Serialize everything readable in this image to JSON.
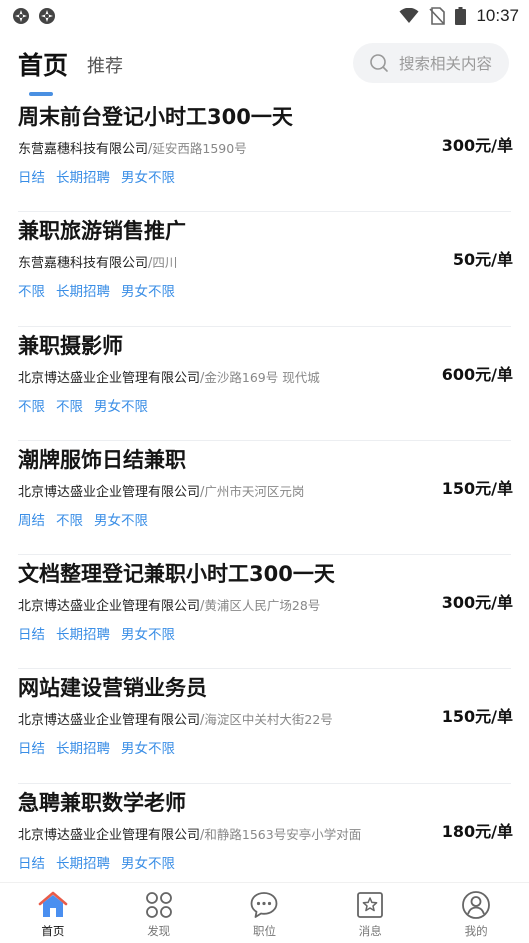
{
  "status_bar": {
    "time": "10:37",
    "icons": [
      "app-notification-icon",
      "app-notification-icon",
      "wifi-icon",
      "no-sim-icon",
      "battery-icon"
    ]
  },
  "header": {
    "tabs": [
      {
        "label": "首页",
        "active": true
      },
      {
        "label": "推荐",
        "active": false
      }
    ],
    "search_placeholder": "搜索相关内容"
  },
  "jobs": [
    {
      "title": "周末前台登记小时工300一天",
      "company": "东营嘉穗科技有限公司",
      "location": "延安西路1590号",
      "tags": [
        "日结",
        "长期招聘",
        "男女不限"
      ],
      "salary": "300元/单"
    },
    {
      "title": "兼职旅游销售推广",
      "company": "东营嘉穗科技有限公司",
      "location": "四川",
      "tags": [
        "不限",
        "长期招聘",
        "男女不限"
      ],
      "salary": "50元/单"
    },
    {
      "title": "兼职摄影师",
      "company": "北京博达盛业企业管理有限公司",
      "location": "金沙路169号 现代城",
      "tags": [
        "不限",
        "不限",
        "男女不限"
      ],
      "salary": "600元/单"
    },
    {
      "title": "潮牌服饰日结兼职",
      "company": "北京博达盛业企业管理有限公司",
      "location": "广州市天河区元岗",
      "tags": [
        "周结",
        "不限",
        "男女不限"
      ],
      "salary": "150元/单"
    },
    {
      "title": "文档整理登记兼职小时工300一天",
      "company": "北京博达盛业企业管理有限公司",
      "location": "黄浦区人民广场28号",
      "tags": [
        "日结",
        "长期招聘",
        "男女不限"
      ],
      "salary": "300元/单"
    },
    {
      "title": "网站建设营销业务员",
      "company": "北京博达盛业企业管理有限公司",
      "location": "海淀区中关村大街22号",
      "tags": [
        "日结",
        "长期招聘",
        "男女不限"
      ],
      "salary": "150元/单"
    },
    {
      "title": "急聘兼职数学老师",
      "company": "北京博达盛业企业管理有限公司",
      "location": "和静路1563号安亭小学对面",
      "tags": [
        "日结",
        "长期招聘",
        "男女不限"
      ],
      "salary": "180元/单"
    }
  ],
  "bottom_nav": [
    {
      "label": "首页",
      "icon": "home-icon",
      "active": true
    },
    {
      "label": "发现",
      "icon": "discover-icon",
      "active": false
    },
    {
      "label": "职位",
      "icon": "chat-icon",
      "active": false
    },
    {
      "label": "消息",
      "icon": "message-star-icon",
      "active": false
    },
    {
      "label": "我的",
      "icon": "profile-icon",
      "active": false
    }
  ],
  "colors": {
    "accent": "#4a90e2",
    "tag": "#3a8ee6",
    "home_icon": "#4a8ff0"
  }
}
